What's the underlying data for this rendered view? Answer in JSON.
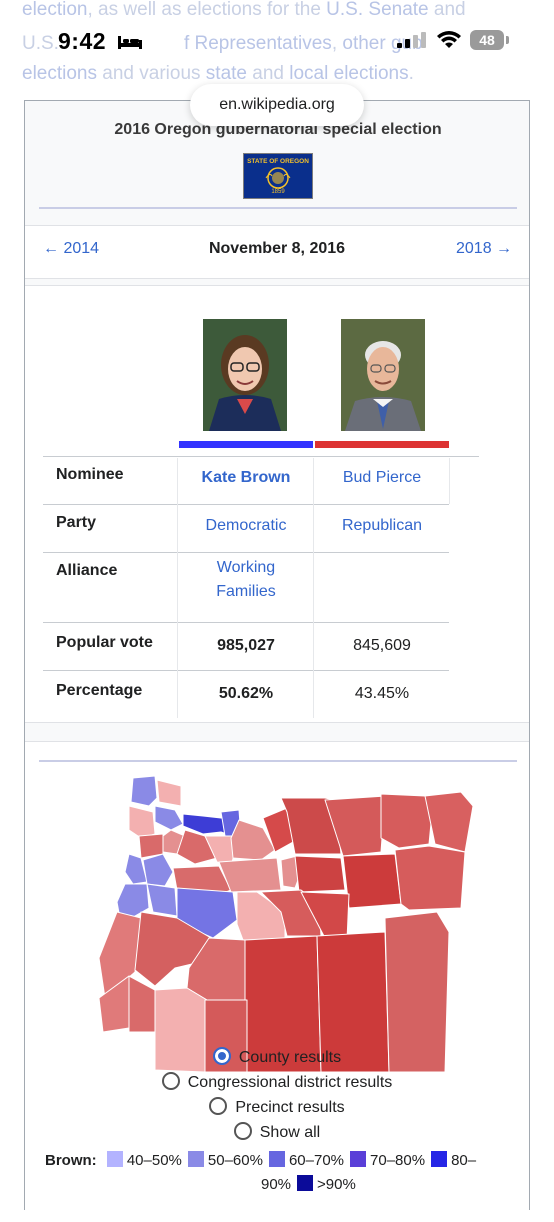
{
  "background_text": {
    "line1": [
      "election",
      ", as well as elections for the ",
      "U.S. Senate",
      " and"
    ],
    "line2": [
      "U.S.",
      " ",
      "f Representatives",
      ", ",
      "other gub",
      "",
      "al"
    ],
    "line3": [
      "elections",
      " and various ",
      "state",
      " and ",
      "local elections",
      "."
    ]
  },
  "status_bar": {
    "time": "9:42",
    "battery": "48"
  },
  "browser": {
    "url": "en.wikipedia.org"
  },
  "infobox": {
    "title": "2016 Oregon gubernatorial special election",
    "flag": {
      "top_text": "STATE OF OREGON",
      "year": "1859"
    },
    "nav": {
      "prev": "← 2014",
      "date": "November 8, 2016",
      "next": "2018 →"
    },
    "candidates": [
      {
        "color": "#3333ff"
      },
      {
        "color": "#dd3333"
      }
    ],
    "table": {
      "rows": [
        {
          "label": "Nominee",
          "c1": "Kate Brown",
          "c2": "Bud Pierce"
        },
        {
          "label": "Party",
          "c1": "Democratic",
          "c2": "Republican"
        },
        {
          "label": "Alliance",
          "c1": "Working Families",
          "c2": ""
        },
        {
          "label": "Popular vote",
          "c1": "985,027",
          "c2": "845,609"
        },
        {
          "label": "Percentage",
          "c1": "50.62%",
          "c2": "43.45%"
        }
      ]
    },
    "map_options": [
      "County results",
      "Congressional district results",
      "Precinct results",
      "Show all"
    ],
    "legend": {
      "label": "Brown:",
      "items": [
        {
          "text": "40–50%",
          "color": "#b3b3ff"
        },
        {
          "text": "50–60%",
          "color": "#8a8ae6"
        },
        {
          "text": "60–70%",
          "color": "#6666e0"
        },
        {
          "text": "70–80%",
          "color": "#5a3fd8"
        },
        {
          "text": "80–",
          "color": "#2626e6"
        },
        {
          "text": "90%",
          "color": ""
        },
        {
          "text": ">90%",
          "color": "#0b0b99"
        }
      ]
    }
  }
}
